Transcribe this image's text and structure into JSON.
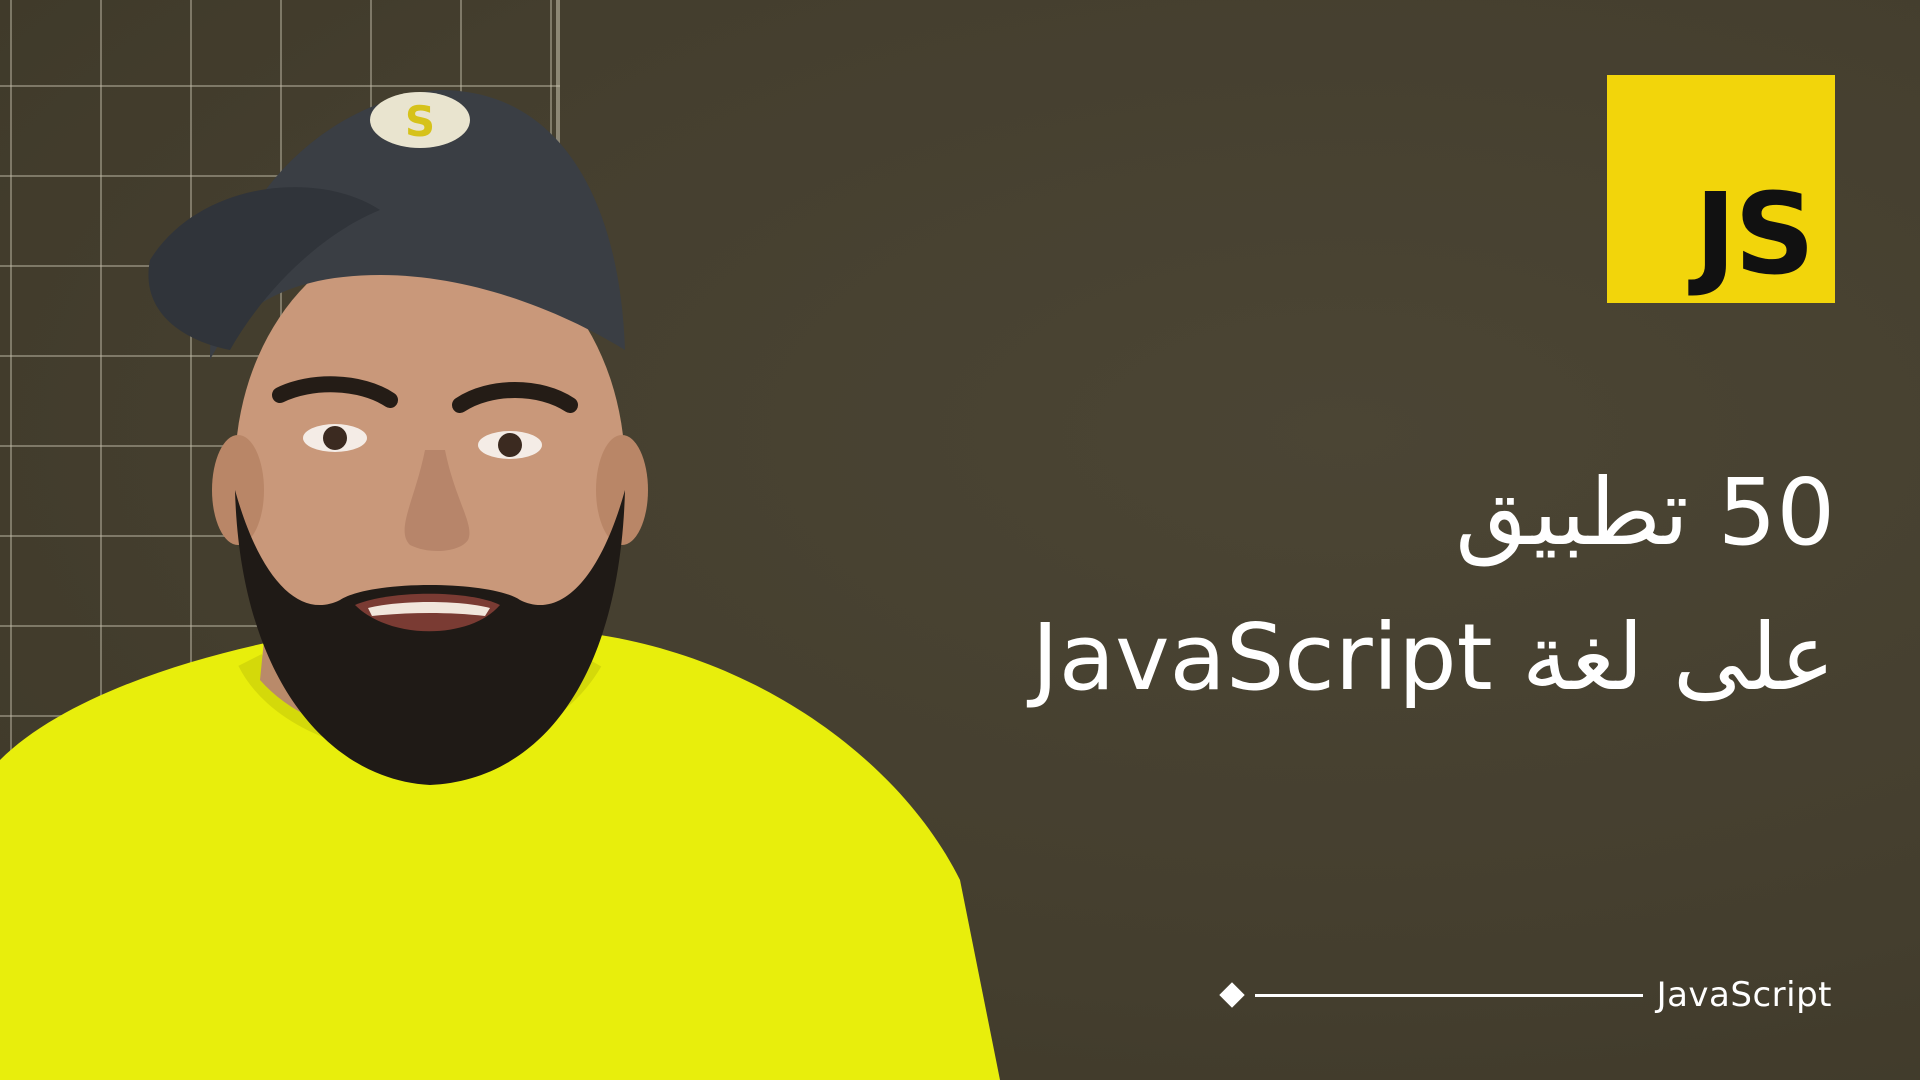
{
  "logo": {
    "text": "JS",
    "color": "#f2d50b"
  },
  "headline": {
    "line1": "50 تطبيق",
    "line2": "على لغة JavaScript"
  },
  "footer": {
    "label": "JavaScript"
  },
  "colors": {
    "background": "#47412f",
    "accent": "#f2d50b",
    "shirt": "#e8ee0c",
    "text": "#ffffff"
  }
}
